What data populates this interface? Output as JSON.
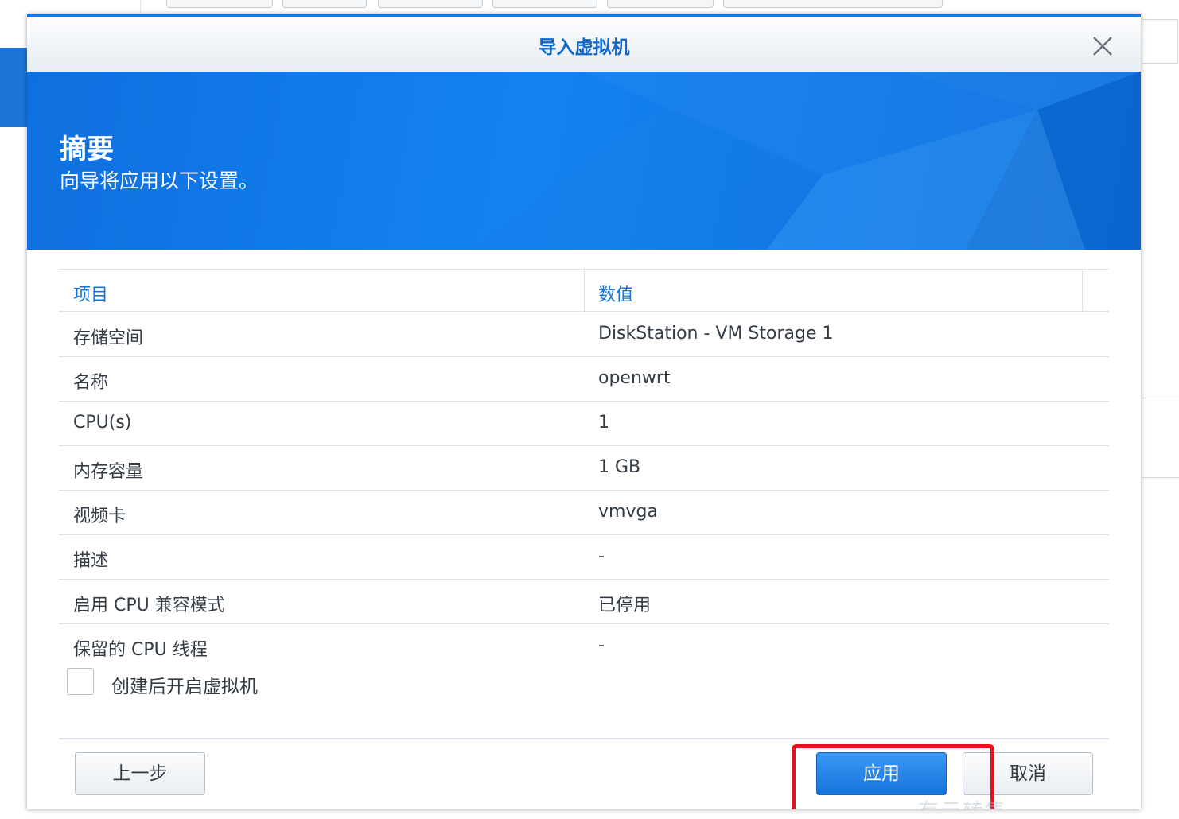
{
  "dialog": {
    "title": "导入虚拟机",
    "banner_title": "摘要",
    "banner_subtitle": "向导将应用以下设置。"
  },
  "table": {
    "headers": [
      "项目",
      "数值"
    ],
    "rows": [
      {
        "item": "存储空间",
        "value": "DiskStation - VM Storage 1"
      },
      {
        "item": "名称",
        "value": "openwrt"
      },
      {
        "item": "CPU(s)",
        "value": "1"
      },
      {
        "item": "内存容量",
        "value": "1 GB"
      },
      {
        "item": "视频卡",
        "value": "vmvga"
      },
      {
        "item": "描述",
        "value": "-"
      },
      {
        "item": "启用 CPU 兼容模式",
        "value": "已停用"
      },
      {
        "item": "保留的 CPU 线程",
        "value": "-"
      }
    ]
  },
  "options": {
    "power_on_label": "创建后开启虚拟机",
    "power_on_checked": false
  },
  "buttons": {
    "prev": "上一步",
    "apply": "应用",
    "cancel": "取消"
  },
  "watermark": "有云转售",
  "colors": {
    "accent": "#1876e0",
    "header_text": "#1a72d4",
    "highlight": "#e8111b"
  },
  "icons": {
    "close": "close-icon"
  }
}
